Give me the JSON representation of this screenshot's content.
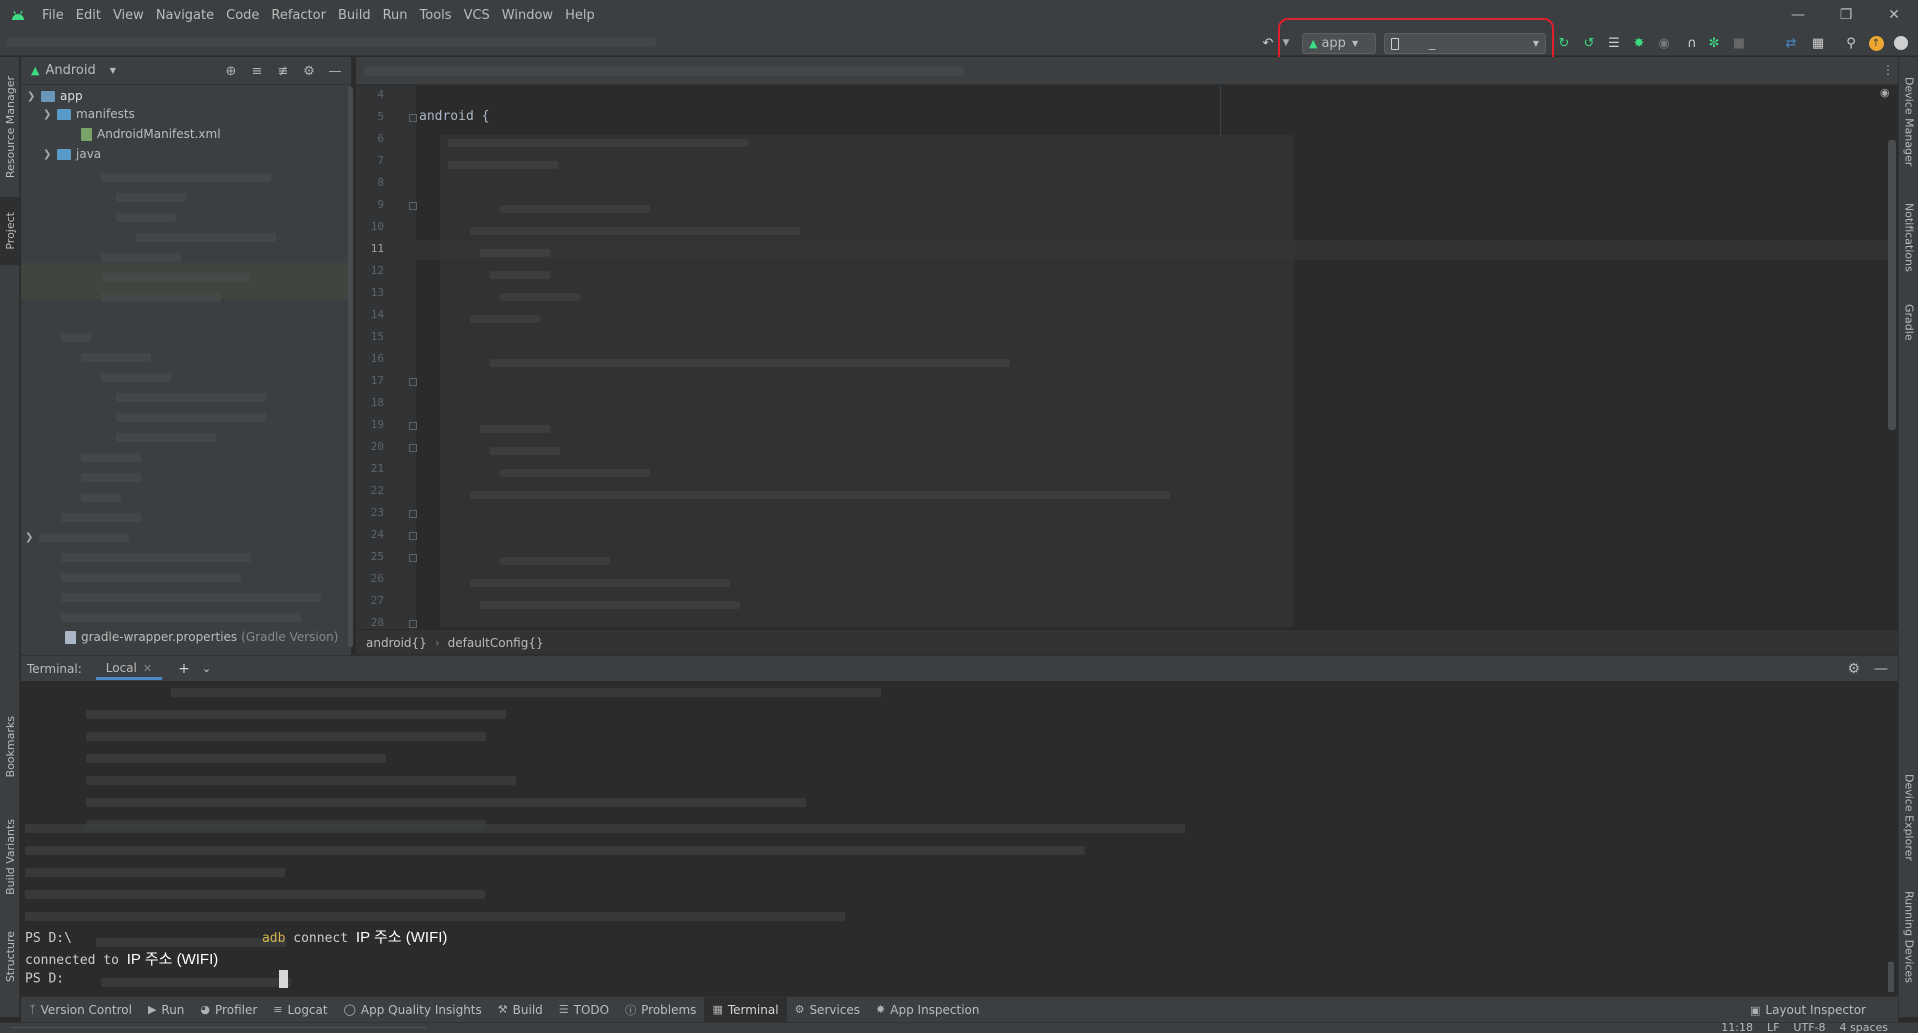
{
  "menu": [
    "File",
    "Edit",
    "View",
    "Navigate",
    "Code",
    "Refactor",
    "Build",
    "Run",
    "Tools",
    "VCS",
    "Window",
    "Help"
  ],
  "toolbar": {
    "run_config": "app",
    "device_selector": "_"
  },
  "left_strip": {
    "resource_manager": "Resource Manager",
    "project": "Project",
    "bookmarks": "Bookmarks",
    "build_variants": "Build Variants",
    "structure": "Structure"
  },
  "right_strip": {
    "device_manager": "Device Manager",
    "notifications": "Notifications",
    "gradle": "Gradle",
    "device_explorer": "Device Explorer",
    "running_devices": "Running Devices"
  },
  "project_panel": {
    "view": "Android",
    "tree": {
      "app": "app",
      "manifests": "manifests",
      "manifest_file": "AndroidManifest.xml",
      "java": "java",
      "gradle_wrapper": "gradle-wrapper.properties",
      "gradle_wrapper_note": "(Gradle Version)"
    }
  },
  "editor": {
    "line_numbers": [
      "4",
      "5",
      "6",
      "7",
      "8",
      "9",
      "10",
      "11",
      "12",
      "13",
      "14",
      "15",
      "16",
      "17",
      "18",
      "19",
      "20",
      "21",
      "22",
      "23",
      "24",
      "25",
      "26",
      "27",
      "28"
    ],
    "current_line": "11",
    "code_line_5": "android {",
    "breadcrumbs": [
      "android{}",
      "defaultConfig{}"
    ]
  },
  "terminal": {
    "label": "Terminal:",
    "tab": "Local",
    "prompt_1": "PS D:\\",
    "cmd_adb": "adb",
    "cmd_connect": "connect",
    "cmd_arg": "IP 주소 (WIFI)",
    "connected_to": "connected to",
    "connected_arg": "IP 주소 (WIFI)",
    "prompt_2": "PS D:"
  },
  "bottom_bar": [
    {
      "icon": "version-control-icon",
      "label": "Version Control"
    },
    {
      "icon": "run-icon",
      "label": "Run"
    },
    {
      "icon": "profiler-icon",
      "label": "Profiler"
    },
    {
      "icon": "logcat-icon",
      "label": "Logcat"
    },
    {
      "icon": "app-quality-icon",
      "label": "App Quality Insights"
    },
    {
      "icon": "build-icon",
      "label": "Build"
    },
    {
      "icon": "todo-icon",
      "label": "TODO"
    },
    {
      "icon": "problems-icon",
      "label": "Problems"
    },
    {
      "icon": "terminal-icon",
      "label": "Terminal"
    },
    {
      "icon": "services-icon",
      "label": "Services"
    },
    {
      "icon": "app-inspection-icon",
      "label": "App Inspection"
    }
  ],
  "layout_inspector": "Layout Inspector",
  "status": {
    "position": "11:18",
    "line_ending": "LF",
    "encoding": "UTF-8",
    "indent": "4 spaces"
  },
  "colors": {
    "highlight": "#e0202a",
    "android_green": "#3ddc84",
    "accent_blue": "#4a88c7",
    "terminal_keyword": "#d1b34e"
  }
}
